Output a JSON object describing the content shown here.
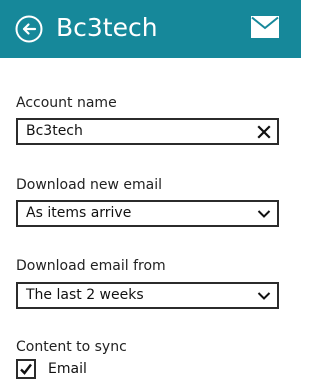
{
  "header": {
    "title": "Bc3tech",
    "background_color": "#16889a",
    "back_icon": "back-arrow-circle-icon",
    "mail_icon": "envelope-icon"
  },
  "account_name": {
    "label": "Account name",
    "value": "Bc3tech",
    "clear_icon": "close-x-icon"
  },
  "download_new_email": {
    "label": "Download new email",
    "selected": "As items arrive",
    "icon": "chevron-down-icon"
  },
  "download_email_from": {
    "label": "Download email from",
    "selected": "The last 2 weeks",
    "icon": "chevron-down-icon"
  },
  "content_to_sync": {
    "label": "Content to sync",
    "items": [
      {
        "label": "Email",
        "checked": true
      }
    ]
  }
}
